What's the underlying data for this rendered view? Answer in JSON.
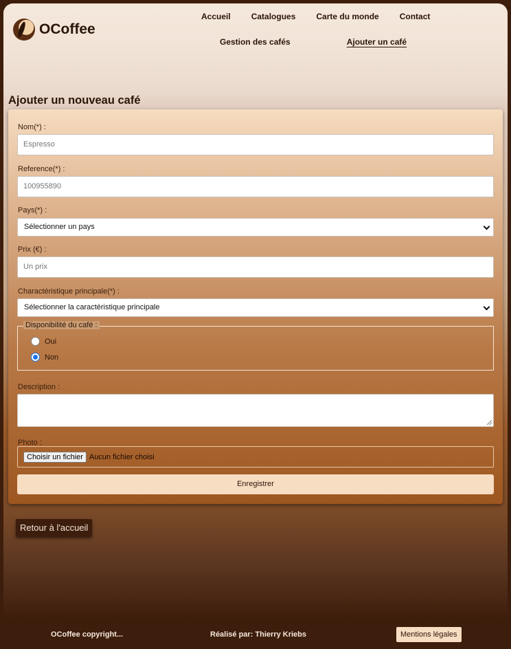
{
  "header": {
    "brand": "OCoffee",
    "nav_row1": [
      "Accueil",
      "Catalogues",
      "Carte du monde",
      "Contact"
    ],
    "nav_row2": [
      "Gestion des cafés",
      "Ajouter un café"
    ],
    "active_nav": "Ajouter un café"
  },
  "page_title": "Ajouter un nouveau café",
  "form": {
    "name_label": "Nom(*) :",
    "name_placeholder": "Espresso",
    "ref_label": "Reference(*) :",
    "ref_placeholder": "100955890",
    "country_label": "Pays(*) :",
    "country_selected": "Sélectionner un pays",
    "price_label": "Prix (€) :",
    "price_placeholder": "Un prix",
    "feature_label": "Charactéristique principale(*) :",
    "feature_selected": "Sélectionner la caractéristique principale",
    "availability_legend": "Disponibilité du café :",
    "availability_yes": "Oui",
    "availability_no": "Non",
    "availability_checked": "Non",
    "description_label": "Description :",
    "photo_label": "Photo :",
    "file_button": "Choisir un fichier",
    "file_none": "Aucun fichier choisi",
    "submit": "Enregistrer"
  },
  "back_button": "Retour à l'accueil",
  "footer": {
    "copyright": "OCoffee copyright...",
    "credit": "Réalisé par: Thierry Kriebs",
    "legal": "Mentions légales"
  }
}
